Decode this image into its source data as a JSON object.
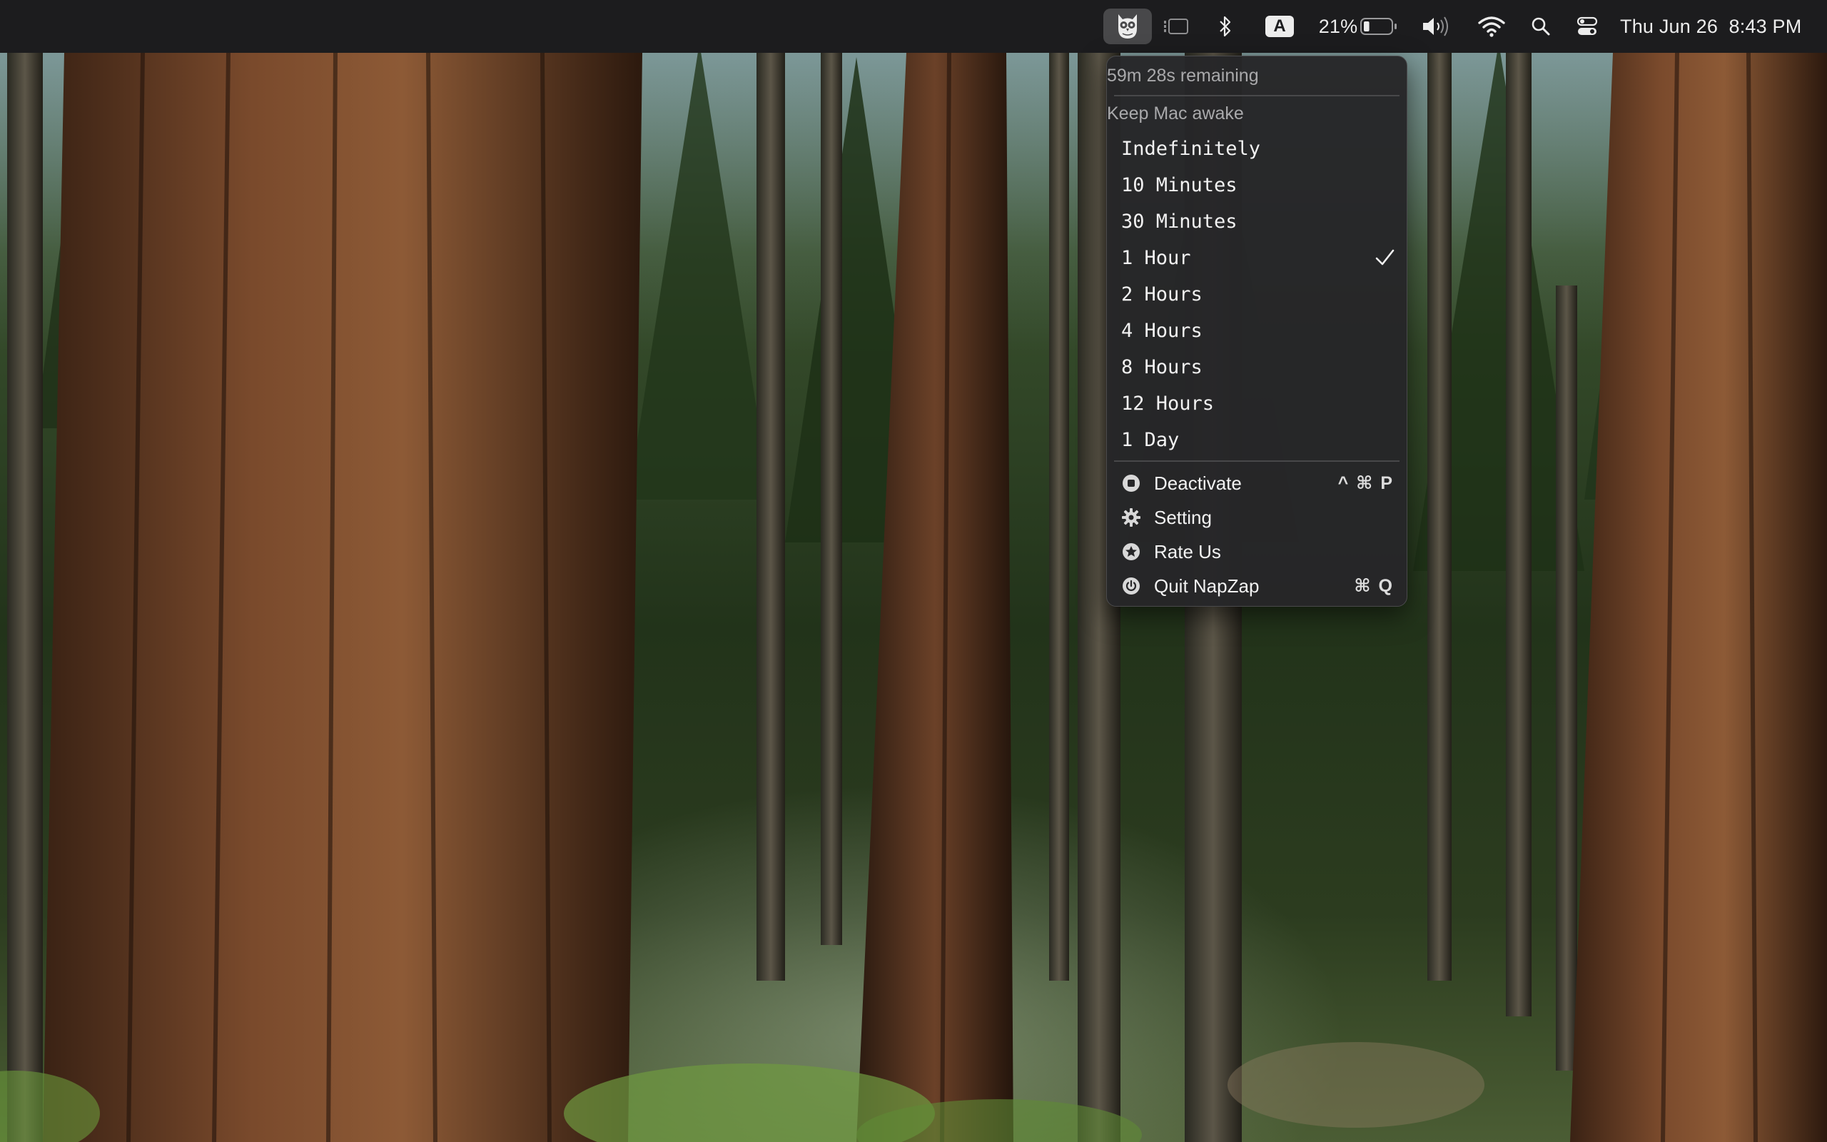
{
  "menubar": {
    "app_icon": "owl-icon",
    "stage_manager_icon": "sidebar-icon",
    "bluetooth_icon": "bluetooth-icon",
    "input_source": "A",
    "battery_percent": "21%",
    "battery_level": 0.21,
    "volume_icon": "speaker-icon",
    "wifi_icon": "wifi-icon",
    "search_icon": "search-icon",
    "control_center_icon": "control-center-icon",
    "datetime": "Thu Jun 26  8:43 PM"
  },
  "menu": {
    "status": "59m 28s remaining",
    "section_header": "Keep Mac awake",
    "durations": [
      {
        "label": "Indefinitely",
        "checked": false
      },
      {
        "label": "10 Minutes",
        "checked": false
      },
      {
        "label": "30 Minutes",
        "checked": false
      },
      {
        "label": "1 Hour",
        "checked": true
      },
      {
        "label": "2 Hours",
        "checked": false
      },
      {
        "label": "4 Hours",
        "checked": false
      },
      {
        "label": "8 Hours",
        "checked": false
      },
      {
        "label": "12 Hours",
        "checked": false
      },
      {
        "label": "1 Day",
        "checked": false
      }
    ],
    "actions": [
      {
        "label": "Deactivate",
        "icon": "stop-circle-icon",
        "shortcut": "^ ⌘ P"
      },
      {
        "label": "Setting",
        "icon": "gear-icon",
        "shortcut": ""
      },
      {
        "label": "Rate Us",
        "icon": "star-circle-icon",
        "shortcut": ""
      },
      {
        "label": "Quit NapZap",
        "icon": "power-icon",
        "shortcut": "⌘ Q"
      }
    ]
  },
  "colors": {
    "menubar_bg": "#1c1c1e",
    "menu_bg": "#262628",
    "menu_text": "#f2f2f2",
    "menu_secondary_text": "#a9a9ab"
  }
}
